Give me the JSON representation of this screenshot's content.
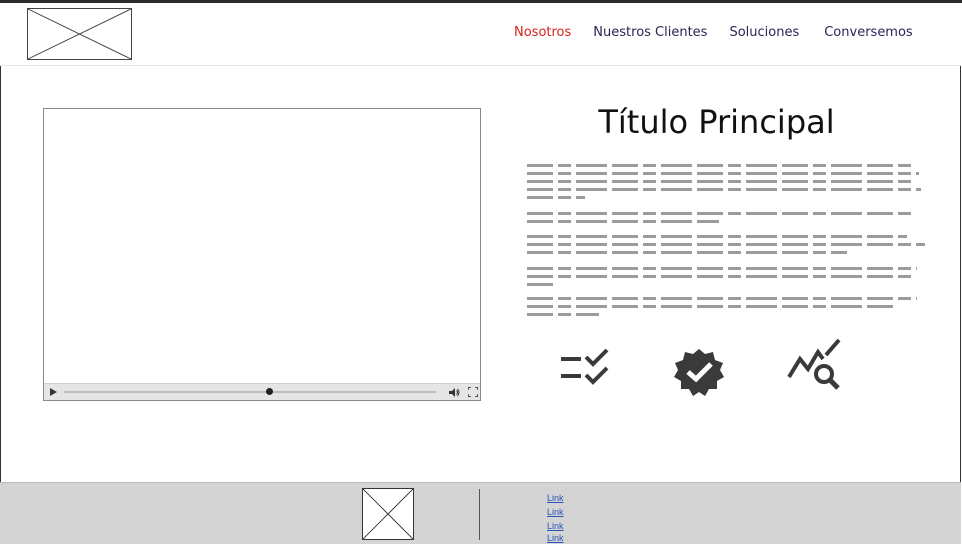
{
  "header": {
    "logo_icon": "image-placeholder-icon",
    "nav": [
      {
        "label": "Nosotros",
        "active": true
      },
      {
        "label": "Nuestros Clientes",
        "active": false
      },
      {
        "label": "Soluciones",
        "active": false
      },
      {
        "label": "Conversemos",
        "active": false
      }
    ]
  },
  "main": {
    "video": {
      "controls": [
        "play-icon",
        "seek-slider",
        "volume-icon",
        "fullscreen-icon"
      ],
      "progress_fraction": 0.55
    },
    "title": "Título Principal",
    "feature_icons": [
      "checklist-icon",
      "verified-badge-icon",
      "trend-search-icon"
    ]
  },
  "footer": {
    "logo_icon": "image-placeholder-icon",
    "links": [
      "Link",
      "Link",
      "Link",
      "Link"
    ]
  },
  "colors": {
    "nav_text": "#2a2456",
    "nav_active": "#d9211c",
    "footer_bg": "#d4d4d4",
    "link": "#2855b8",
    "icon": "#3a3a3a"
  }
}
